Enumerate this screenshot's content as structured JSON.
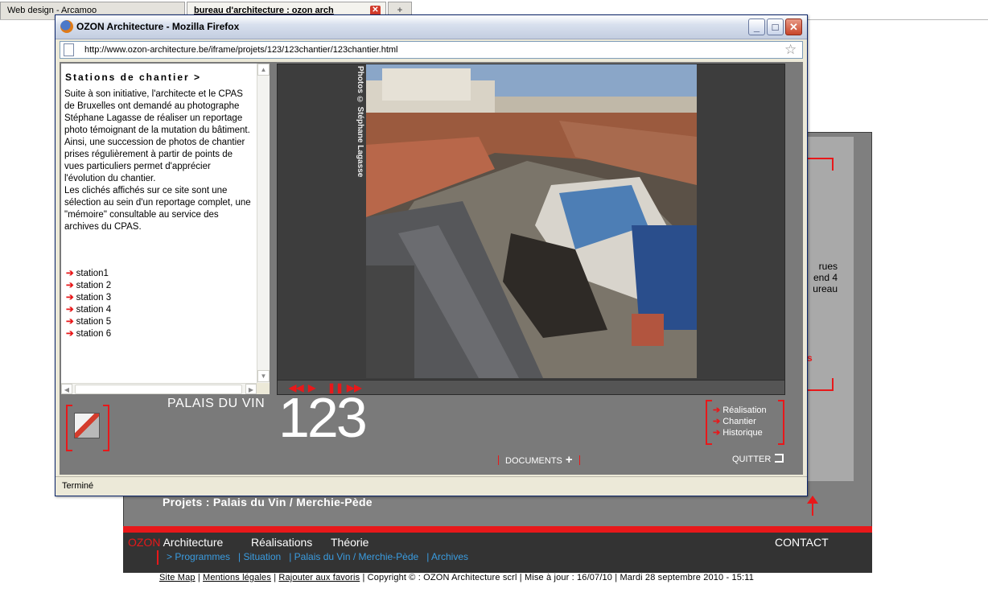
{
  "browser_tabs": [
    {
      "label": "Web design - Arcamoo"
    },
    {
      "label": "bureau d'architecture : ozon arch"
    },
    {
      "label": "+"
    }
  ],
  "background_site": {
    "project_title": "Projets : Palais du Vin / Merchie-Pède",
    "partial_text_lines": [
      "rues",
      "end 4",
      "ureau"
    ],
    "partial_red_text": "s",
    "nav": {
      "brand_red": "OZON",
      "brand_white": " Architecture",
      "realisations": "Réalisations",
      "theorie": "Théorie",
      "contact": "CONTACT"
    },
    "subnav": [
      "> Programmes",
      "| Situation",
      "| Palais du Vin / Merchie-Pède",
      "| Archives"
    ],
    "footer": {
      "site_map": "Site Map",
      "mentions": "Mentions légales",
      "favoris": "Rajouter aux favoris",
      "rest": "| Copyright © : OZON Architecture scrl | Mise à jour : 16/07/10 | Mardi 28 septembre 2010 - 15:11"
    },
    "accent_color": "#e8181a"
  },
  "popup": {
    "title": "OZON Architecture - Mozilla Firefox",
    "url": "http://www.ozon-architecture.be/iframe/projets/123/123chantier/123chantier.html",
    "status": "Terminé",
    "text_panel": {
      "title": "Stations de chantier >",
      "paragraphs": [
        "Suite à son initiative, l'architecte et le CPAS de Bruxelles ont demandé au photographe Stéphane Lagasse de réaliser un reportage photo témoignant de la mutation du bâtiment.",
        "Ainsi, une succession de photos de chantier prises régulièrement à partir de points de vues particuliers permet d'apprécier l'évolution du chantier.",
        "Les clichés affichés sur ce site sont une sélection au sein d'un reportage complet, une \"mémoire\" consultable au service des archives du CPAS."
      ],
      "stations": [
        "station1",
        "station 2",
        "station 3",
        "station 4",
        "station 5",
        "station 6"
      ]
    },
    "photo_credit": "Photos © Stéphane Lagasse",
    "controls": {
      "rewind": "◀◀",
      "play": "▶",
      "pause": "❚❚",
      "forward": "▶▶"
    },
    "project_name": "PALAIS DU VIN",
    "project_number": "123",
    "right_links": [
      "Réalisation",
      "Chantier",
      "Historique"
    ],
    "documents_label": "DOCUMENTS",
    "quit_label": "QUITTER"
  }
}
